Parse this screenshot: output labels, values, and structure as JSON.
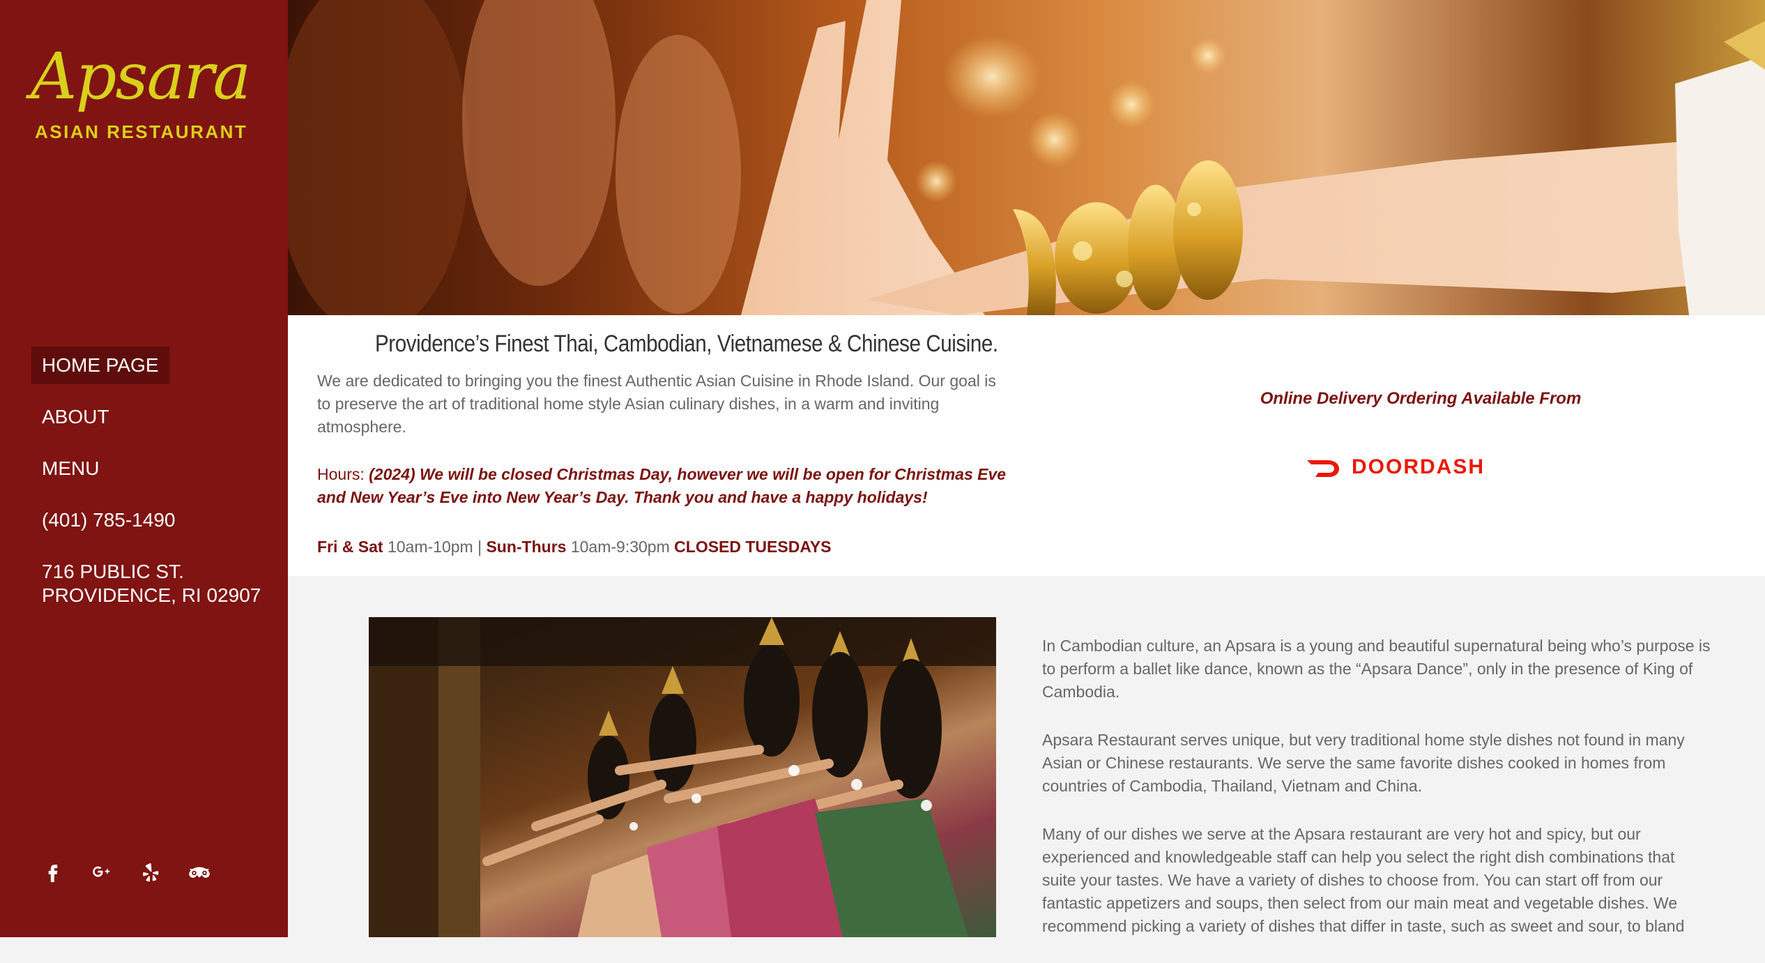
{
  "sidebar": {
    "logo": {
      "script": "Apsara",
      "subtitle": "ASIAN  RESTAURANT"
    },
    "nav": [
      {
        "label": "HOME PAGE"
      },
      {
        "label": "ABOUT"
      },
      {
        "label": "MENU"
      },
      {
        "label": "(401) 785-1490"
      }
    ],
    "address": {
      "line1": "716 PUBLIC ST.",
      "line2": "PROVIDENCE, RI 02907"
    },
    "social": [
      "facebook-icon",
      "google-plus-icon",
      "yelp-icon",
      "tripadvisor-icon"
    ]
  },
  "info": {
    "tagline": "Providence’s Finest Thai, Cambodian, Vietnamese & Chinese Cuisine.",
    "intro": "We are dedicated to bringing you the finest Authentic Asian Cuisine in Rhode Island. Our goal is to preserve the art of traditional home style Asian culinary dishes, in a warm and inviting atmosphere.",
    "hours_label": "Hours:",
    "hours_note": "(2024) We will be closed Christmas Day, however we will be open for Christmas Eve and New Year’s Eve into New Year’s Day. Thank you and have a happy holidays!",
    "schedule": {
      "weekend_label": "Fri & Sat",
      "weekend_hours": "10am-10pm |",
      "weekday_label": "Sun-Thurs",
      "weekday_hours": "10am-9:30pm",
      "closed": "CLOSED TUESDAYS"
    },
    "delivery_title": "Online Delivery Ordering Available From",
    "doordash_label": "DOORDASH"
  },
  "about": {
    "p1": "In Cambodian culture, an Apsara is a young and beautiful supernatural being who’s purpose is to perform a ballet like dance, known as the “Apsara Dance”, only in the presence of King of Cambodia.",
    "p2": "Apsara Restaurant serves unique, but very traditional home style dishes not found in many Asian or Chinese restaurants. We serve the same favorite dishes cooked in homes from countries of  Cambodia, Thailand, Vietnam and China.",
    "p3": "Many of our dishes we serve at the Apsara restaurant are very hot and spicy, but our experienced and knowledgeable staff can help you select the right dish combinations that suite your tastes.  We have a variety of dishes to choose from. You can start off from our fantastic appetizers and soups, then select  from our main meat and vegetable dishes. We recommend picking a variety of dishes that differ in taste, such as sweet and sour, to bland"
  },
  "colors": {
    "sidebar": "#7f1412",
    "accent": "#7a1210",
    "logo": "#d9d01b",
    "doordash": "#eb1700"
  }
}
